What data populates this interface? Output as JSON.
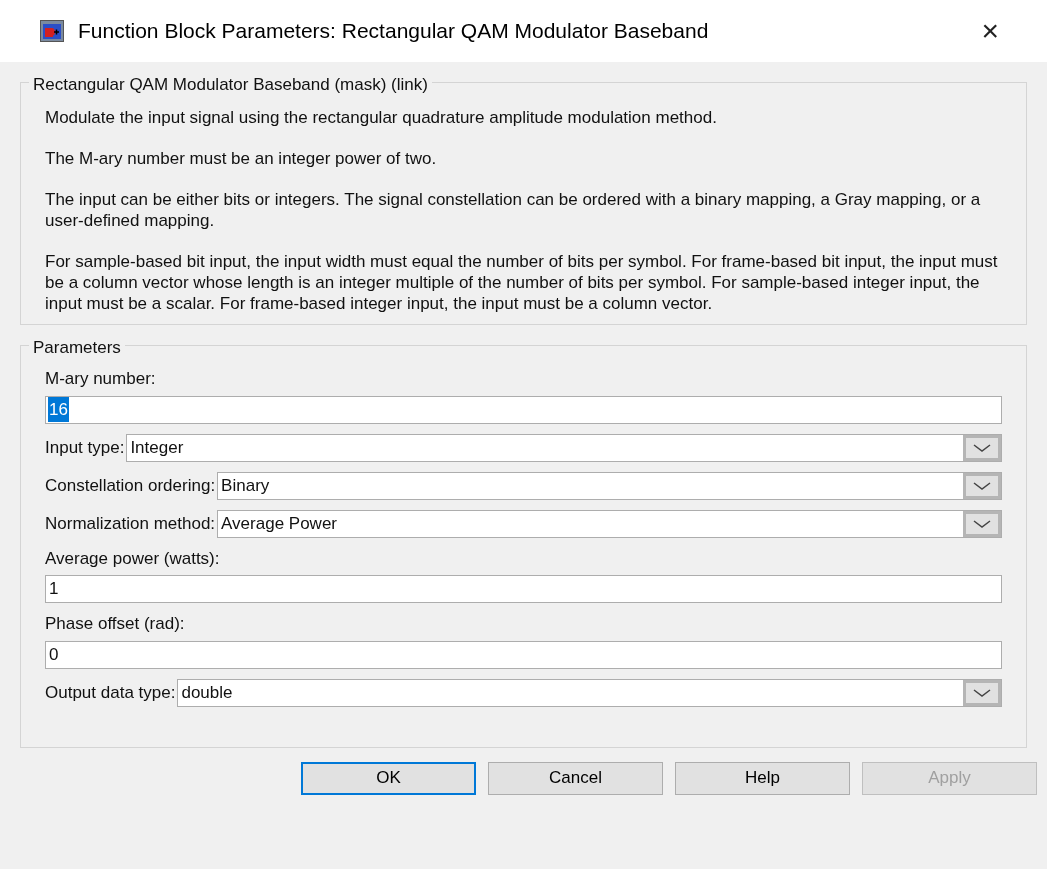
{
  "window": {
    "title": "Function Block Parameters: Rectangular QAM Modulator Baseband",
    "close": "×"
  },
  "description": {
    "title": "Rectangular QAM Modulator Baseband (mask) (link)",
    "paragraphs": [
      "Modulate the input signal using the rectangular quadrature amplitude modulation method.",
      "The M-ary number must be an integer power of two.",
      "The input can be either bits or integers. The signal constellation can be ordered with a binary mapping, a Gray mapping, or a user-defined mapping.",
      "For sample-based bit input, the input width must equal the number of bits per symbol. For frame-based bit input, the input must be a column vector whose length is an integer multiple of the number of bits per symbol. For sample-based integer input, the input must be a scalar. For frame-based integer input, the input must be a column vector."
    ]
  },
  "parameters": {
    "title": "Parameters",
    "items": [
      {
        "kind": "edit",
        "label": "M-ary number:",
        "value": "16",
        "text_selected": true
      },
      {
        "kind": "popup",
        "label": "Input type:",
        "value": "Integer"
      },
      {
        "kind": "popup",
        "label": "Constellation ordering:",
        "value": "Binary"
      },
      {
        "kind": "popup",
        "label": "Normalization method:",
        "value": "Average Power"
      },
      {
        "kind": "edit",
        "label": "Average power (watts):",
        "value": "1",
        "text_selected": false
      },
      {
        "kind": "edit",
        "label": "Phase offset (rad):",
        "value": "0",
        "text_selected": false
      },
      {
        "kind": "popup",
        "label": "Output data type:",
        "value": "double"
      }
    ]
  },
  "buttons": [
    {
      "label": "OK",
      "default": true,
      "disabled": false
    },
    {
      "label": "Cancel",
      "default": false,
      "disabled": false
    },
    {
      "label": "Help",
      "default": false,
      "disabled": false
    },
    {
      "label": "Apply",
      "default": false,
      "disabled": true
    }
  ]
}
